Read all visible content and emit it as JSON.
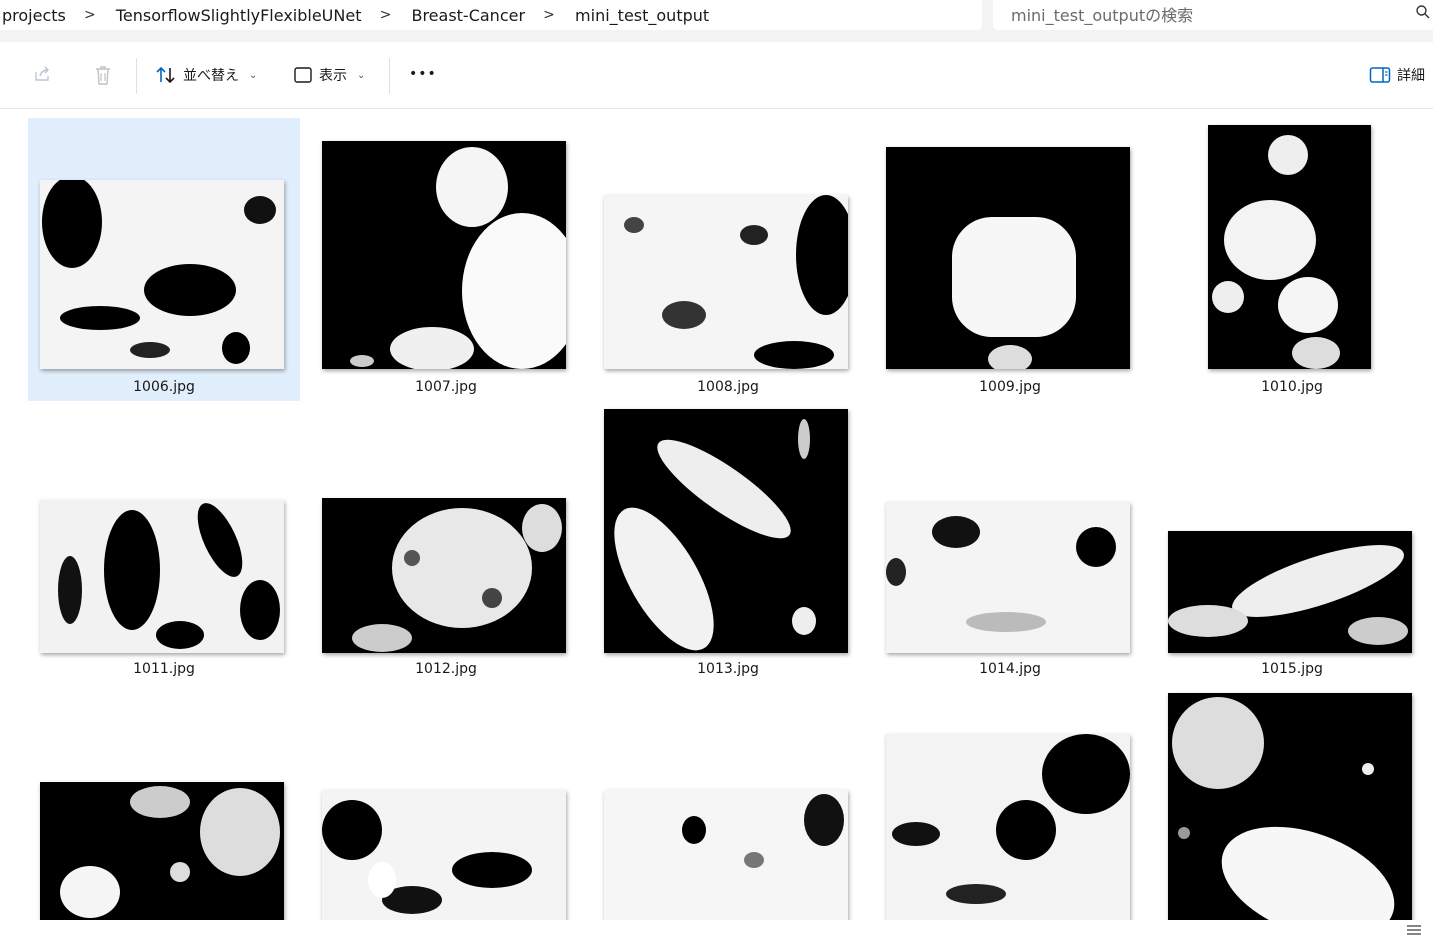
{
  "breadcrumb": [
    "projects",
    "TensorflowSlightlyFlexibleUNet",
    "Breast-Cancer",
    "mini_test_output"
  ],
  "breadcrumb_separator": ">",
  "search": {
    "placeholder": "mini_test_outputの検索"
  },
  "toolbar": {
    "sort_label": "並べ替え",
    "view_label": "表示",
    "more_label": "•••",
    "details_label": "詳細"
  },
  "files": [
    {
      "name": "1006.jpg",
      "selected": true
    },
    {
      "name": "1007.jpg"
    },
    {
      "name": "1008.jpg"
    },
    {
      "name": "1009.jpg"
    },
    {
      "name": "1010.jpg"
    },
    {
      "name": "1011.jpg"
    },
    {
      "name": "1012.jpg"
    },
    {
      "name": "1013.jpg"
    },
    {
      "name": "1014.jpg"
    },
    {
      "name": "1015.jpg"
    },
    {
      "name": ""
    },
    {
      "name": ""
    },
    {
      "name": ""
    },
    {
      "name": ""
    },
    {
      "name": ""
    }
  ],
  "colors": {
    "accent": "#0067c0",
    "selection": "#e1eefb"
  }
}
